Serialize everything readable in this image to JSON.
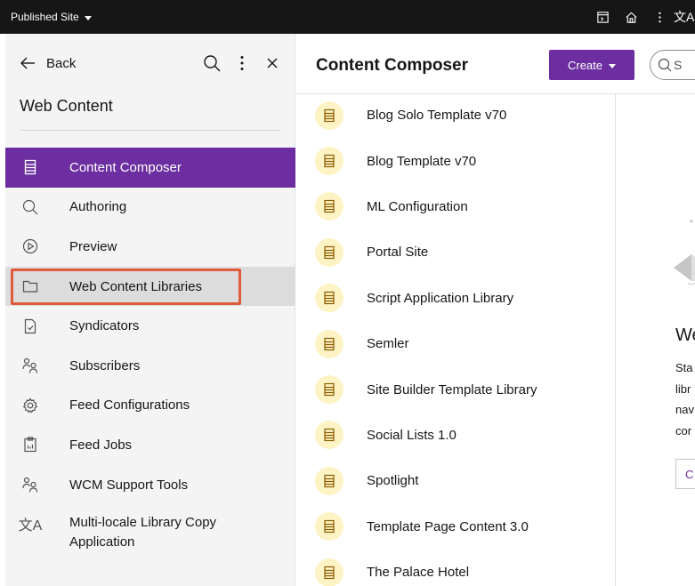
{
  "topbar": {
    "site_label": "Published Site",
    "lang_glyph": "文A"
  },
  "leftpanel": {
    "back_label": "Back",
    "title": "Web Content",
    "items": [
      {
        "label": "Content Composer",
        "icon": "document-list-icon",
        "state": "active"
      },
      {
        "label": "Authoring",
        "icon": "search-icon",
        "state": "normal"
      },
      {
        "label": "Preview",
        "icon": "play-circle-icon",
        "state": "normal"
      },
      {
        "label": "Web Content Libraries",
        "icon": "folder-icon",
        "state": "hover"
      },
      {
        "label": "Syndicators",
        "icon": "document-check-icon",
        "state": "normal"
      },
      {
        "label": "Subscribers",
        "icon": "users-icon",
        "state": "normal"
      },
      {
        "label": "Feed Configurations",
        "icon": "gear-icon",
        "state": "normal"
      },
      {
        "label": "Feed Jobs",
        "icon": "clipboard-chart-icon",
        "state": "normal"
      },
      {
        "label": "WCM Support Tools",
        "icon": "users-icon",
        "state": "normal"
      },
      {
        "label": "Multi-locale Library Copy Application",
        "icon": "translate-icon",
        "state": "normal"
      }
    ]
  },
  "main": {
    "title": "Content Composer",
    "create_label": "Create",
    "search_placeholder": "S",
    "list": [
      "Blog Solo Template v70",
      "Blog Template v70",
      "ML Configuration",
      "Portal Site",
      "Script Application Library",
      "Semler",
      "Site Builder Template Library",
      "Social Lists 1.0",
      "Spotlight",
      "Template Page Content 3.0",
      "The Palace Hotel"
    ]
  },
  "detail": {
    "title": "We",
    "lines": [
      "Sta",
      "libr",
      "nav",
      "cor"
    ],
    "button_label": "C"
  },
  "colors": {
    "accent": "#6c2ea0",
    "topbar": "#161616",
    "highlight": "#e05a3c",
    "badge": "#fdf3c4"
  }
}
